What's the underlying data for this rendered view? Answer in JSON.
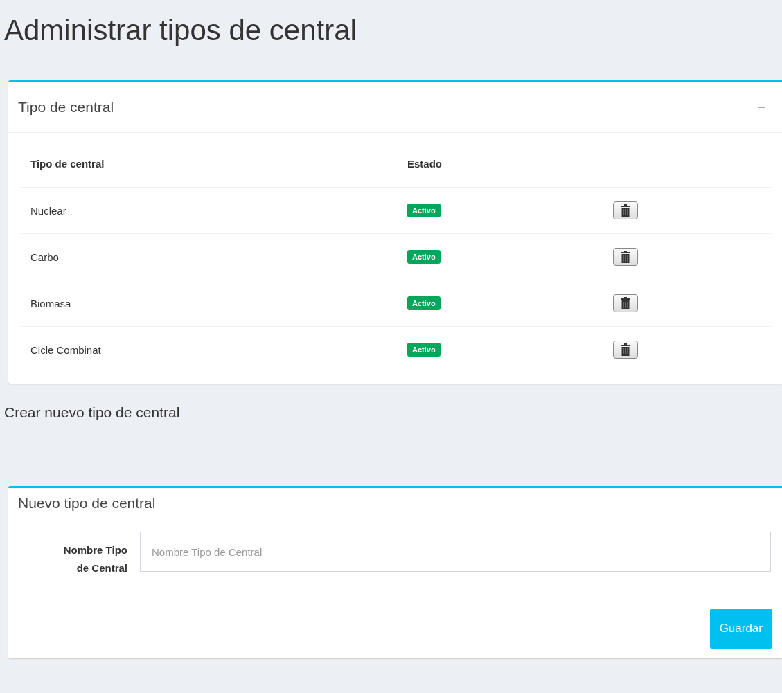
{
  "page_title": "Administrar tipos de central",
  "list_panel": {
    "title": "Tipo de central",
    "collapse_symbol": "−",
    "columns": [
      "Tipo de central",
      "Estado"
    ],
    "rows": [
      {
        "name": "Nuclear",
        "status": {
          "label": "Activo",
          "kind": "success"
        }
      },
      {
        "name": "Carbo",
        "status": {
          "label": "Activo",
          "kind": "success"
        }
      },
      {
        "name": "Biomasa",
        "status": {
          "label": "Activo",
          "kind": "success"
        }
      },
      {
        "name": "Cicle Combinat",
        "status": {
          "label": "Activo",
          "kind": "success"
        }
      }
    ]
  },
  "section_title": "Crear nuevo tipo de central",
  "form_panel": {
    "title": "Nuevo tipo de central",
    "field": {
      "label_lines": [
        "Nombre Tipo",
        "de Central"
      ],
      "placeholder": "Nombre Tipo de Central"
    },
    "submit": "Guardar"
  }
}
